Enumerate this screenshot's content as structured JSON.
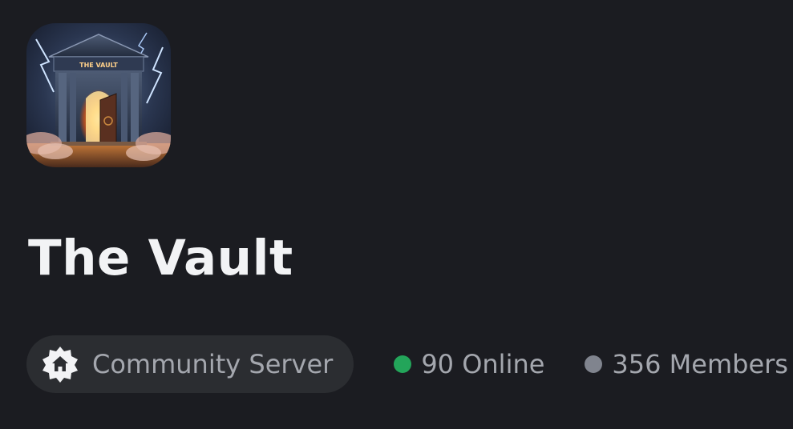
{
  "server": {
    "icon_name": "vault-temple-server-icon",
    "icon_text": "THE VAULT",
    "name": "The Vault"
  },
  "community_badge": {
    "icon": "community-home-badge-icon",
    "label": "Community Server"
  },
  "stats": {
    "online": {
      "label": "90 Online",
      "color": "#23a55a"
    },
    "members": {
      "label": "356 Members",
      "color": "#80848e"
    }
  },
  "colors": {
    "background": "#1b1c21",
    "pill_background": "#2b2d31",
    "title": "#f2f3f5",
    "muted_text": "#a4a7ae"
  }
}
